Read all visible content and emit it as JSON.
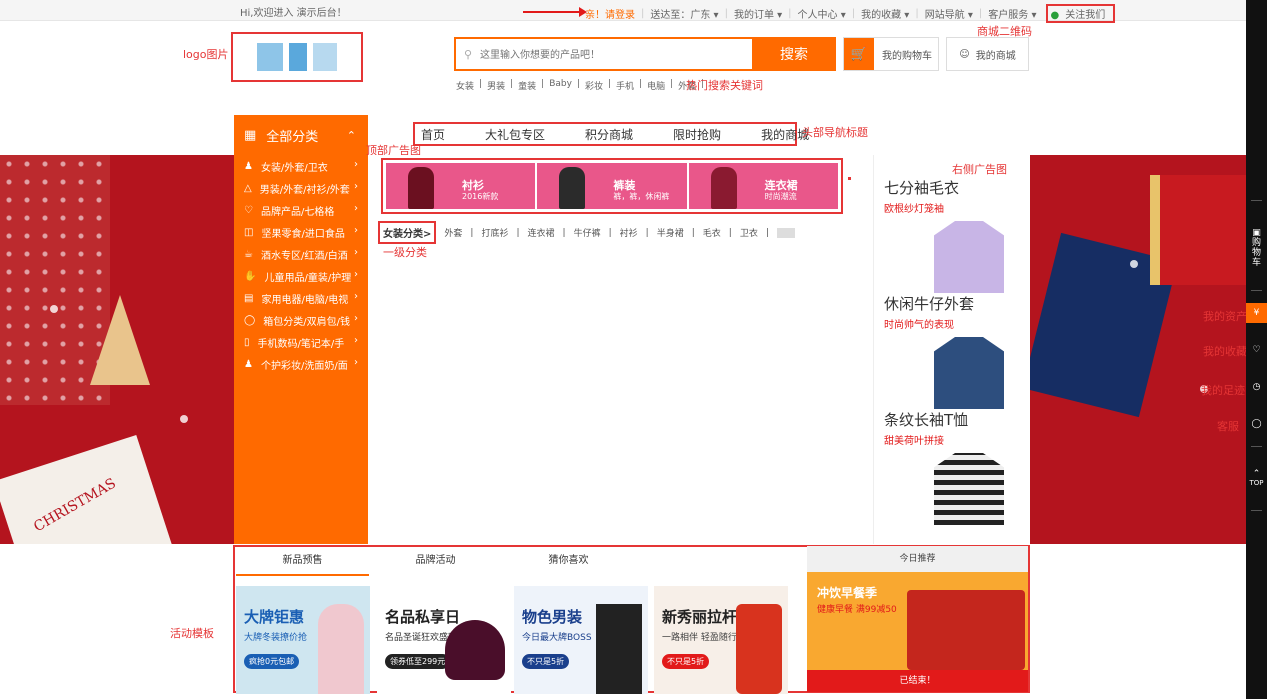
{
  "topbar": {
    "welcome": "Hi,欢迎进入 演示后台！",
    "login": "亲！请登录",
    "delivery": "送达至：广东 ▾",
    "orders": "我的订单 ▾",
    "user_center": "个人中心 ▾",
    "favorites": "我的收藏 ▾",
    "site_nav": "网站导航 ▾",
    "service": "客户服务 ▾",
    "follow": "关注我们"
  },
  "annotations": {
    "qrcode": "商城二维码",
    "logo": "logo图片",
    "hotwords": "热门搜索关键词",
    "nav": "头部导航标题",
    "top_ad": "顶部广告图",
    "right_ad": "右侧广告图",
    "level1": "一级分类",
    "activity": "活动模板"
  },
  "search": {
    "placeholder": "这里输入你想要的产品吧！",
    "button": "搜索"
  },
  "header": {
    "cart": "我的购物车",
    "mystore": "我的商城"
  },
  "hotwords": [
    "女装",
    "|",
    "男装",
    "|",
    "童装",
    "|",
    "Baby",
    "|",
    "彩妆",
    "|",
    "手机",
    "|",
    "电脑",
    "|",
    "外套",
    "|"
  ],
  "nav": {
    "all_categories": "全部分类",
    "items": [
      "首页",
      "大礼包专区",
      "积分商城",
      "限时抢购",
      "我的商城"
    ]
  },
  "categories": [
    "女装/外套/卫衣",
    "男装/外套/衬衫/外套",
    "品牌产品/七格格",
    "坚果零食/进口食品",
    "酒水专区/红酒/白酒",
    "儿童用品/童装/护理",
    "家用电器/电脑/电视",
    "箱包分类/双肩包/钱",
    "手机数码/笔记本/手",
    "个护彩妆/洗面奶/面"
  ],
  "ads": [
    {
      "title": "衬衫",
      "sub": "2016新款"
    },
    {
      "title": "裤装",
      "sub": "裤，裤，休闲裤"
    },
    {
      "title": "连衣裙",
      "sub": "时尚潮流"
    }
  ],
  "subcats": {
    "first": "女装分类>",
    "items": [
      "外套",
      "|",
      "打底衫",
      "|",
      "连衣裙",
      "|",
      "牛仔裤",
      "|",
      "衬衫",
      "|",
      "半身裙",
      "|",
      "毛衣",
      "|",
      "卫衣",
      "|"
    ]
  },
  "right_products": [
    {
      "name": "七分袖毛衣",
      "desc": "欧根纱灯笼袖"
    },
    {
      "name": "休闲牛仔外套",
      "desc": "时尚帅气的表现"
    },
    {
      "name": "条纹长袖T恤",
      "desc": "甜美荷叶拼接"
    }
  ],
  "right_bar": {
    "cart": "购物车",
    "assets_icon": "¥",
    "assets": "我的资产",
    "fav": "我的收藏",
    "footprint": "我的足迹",
    "service": "客服",
    "top": "TOP"
  },
  "banner": {
    "card_text": "CHRISTMAS"
  },
  "activity": {
    "tabs": [
      "新品预售",
      "品牌活动",
      "猜你喜欢"
    ],
    "promos": [
      {
        "title": "大牌钜惠",
        "sub": "大牌冬装撩价抢",
        "badge": "疯抢0元包邮"
      },
      {
        "title": "名品私享日",
        "sub": "名品圣诞狂欢盛宴",
        "badge": "领券低至299元"
      },
      {
        "title": "物色男装",
        "sub": "今日最大牌BOSS",
        "badge": "不只是5折"
      },
      {
        "title": "新秀丽拉杆箱",
        "sub": "一路相伴 轻盈随行",
        "badge": "不只是5折"
      }
    ],
    "today": {
      "header": "今日推荐",
      "title": "冲饮早餐季",
      "sub": "健康早餐 满99减50",
      "end": "已结束！"
    }
  }
}
